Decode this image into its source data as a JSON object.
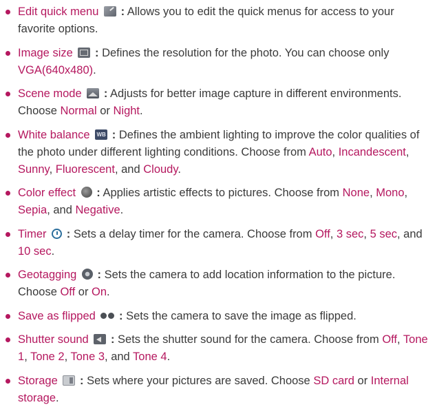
{
  "items": [
    {
      "term": "Edit quick menu",
      "icon": "quick-menu-icon",
      "colon": ":",
      "desc": " Allows you to edit the quick menus for access to your favorite options."
    },
    {
      "term": "Image size",
      "icon": "image-size-icon",
      "colon": ":",
      "desc": " Defines the resolution for the photo. You can choose only ",
      "o1": "VGA(640x480)",
      "end": "."
    },
    {
      "term": "Scene mode",
      "icon": "scene-mode-icon",
      "colon": ":",
      "desc": " Adjusts for better image capture in different environments. Choose ",
      "o1": "Normal",
      "s1": " or ",
      "o2": "Night",
      "end": "."
    },
    {
      "term": "White balance",
      "icon": "white-balance-icon",
      "colon": ":",
      "desc": " Defines the ambient lighting to improve the color qualities of the photo under different lighting conditions. Choose from ",
      "o1": "Auto",
      "s1": ", ",
      "o2": "Incandescent",
      "s2": ", ",
      "o3": "Sunny",
      "s3": ", ",
      "o4": "Fluorescent",
      "s4": ", and ",
      "o5": "Cloudy",
      "end": "."
    },
    {
      "term": "Color effect",
      "icon": "color-effect-icon",
      "colon": ":",
      "desc": " Applies artistic effects to pictures. Choose from ",
      "o1": "None",
      "s1": ", ",
      "o2": "Mono",
      "s2": ", ",
      "o3": "Sepia",
      "s3": ", and ",
      "o4": "Negative",
      "end": "."
    },
    {
      "term": "Timer",
      "icon": "timer-icon",
      "colon": ":",
      "desc": " Sets a delay timer for the camera. Choose from ",
      "o1": "Off",
      "s1": ", ",
      "o2": "3 sec",
      "s2": ", ",
      "o3": "5 sec",
      "s3": ", and ",
      "o4": "10 sec",
      "end": "."
    },
    {
      "term": "Geotagging",
      "icon": "geotagging-icon",
      "colon": ":",
      "desc": " Sets the camera to add location information to the picture. Choose ",
      "o1": "Off",
      "s1": " or ",
      "o2": "On",
      "end": "."
    },
    {
      "term": "Save as flipped",
      "icon": "save-as-flipped-icon",
      "colon": ":",
      "desc": " Sets the camera to save the image as flipped."
    },
    {
      "term": "Shutter sound",
      "icon": "shutter-sound-icon",
      "colon": ":",
      "desc": " Sets the shutter sound for the camera. Choose from ",
      "o1": "Off",
      "s1": ", ",
      "o2": "Tone 1",
      "s2": ", ",
      "o3": "Tone 2",
      "s3": ", ",
      "o4": "Tone 3",
      "s4": ", and ",
      "o5": "Tone 4",
      "end": "."
    },
    {
      "term": "Storage",
      "icon": "storage-icon",
      "colon": ":",
      "desc": " Sets where your pictures are saved. Choose ",
      "o1": "SD card",
      "s1": " or ",
      "o2": "Internal storage",
      "end": "."
    }
  ],
  "colors": {
    "accent": "#b5185f",
    "text": "#3a3a3a"
  }
}
